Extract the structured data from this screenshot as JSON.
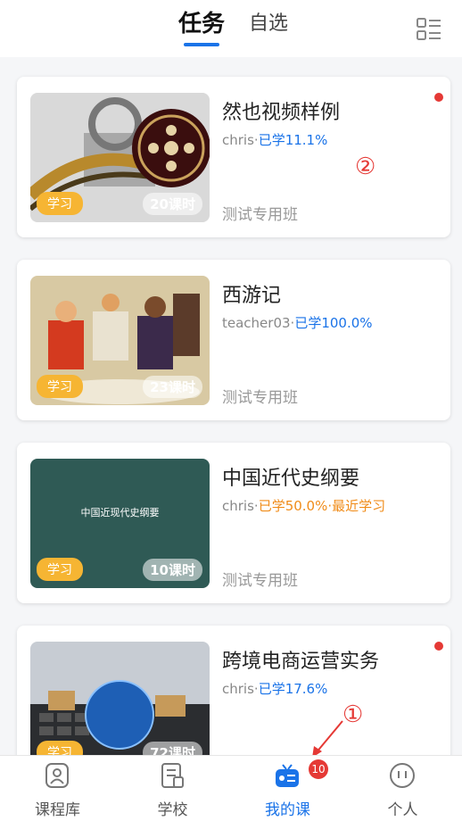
{
  "tabs": [
    {
      "label": "任务",
      "active": true
    },
    {
      "label": "自选",
      "active": false
    }
  ],
  "courses": [
    {
      "title": "然也视频样例",
      "teacher": "chris",
      "separator": "·",
      "progress": "已学11.1%",
      "progress_color": "#1a73e8",
      "study_badge": "学习",
      "hours": "20课时",
      "class_name": "测试专用班",
      "unread": true
    },
    {
      "title": "西游记",
      "teacher": "teacher03",
      "separator": "·",
      "progress": "已学100.0%",
      "progress_color": "#1a73e8",
      "study_badge": "学习",
      "hours": "23课时",
      "class_name": "测试专用班",
      "unread": false
    },
    {
      "title": "中国近代史纲要",
      "teacher": "chris",
      "separator": "·",
      "progress": "已学50.0%·最近学习",
      "progress_color": "#f08c1a",
      "study_badge": "学习",
      "hours": "10课时",
      "class_name": "测试专用班",
      "thumb_text": "中国近现代史纲要",
      "unread": false
    },
    {
      "title": "跨境电商运营实务",
      "teacher": "chris",
      "separator": "·",
      "progress": "已学17.6%",
      "progress_color": "#1a73e8",
      "study_badge": "学习",
      "hours": "72课时",
      "class_name": "测试专用班",
      "unread": true
    }
  ],
  "annotations": {
    "one": "①",
    "two": "②"
  },
  "bottom_nav": [
    {
      "label": "课程库",
      "icon": "course-library-icon"
    },
    {
      "label": "学校",
      "icon": "school-icon"
    },
    {
      "label": "我的课",
      "icon": "tv-icon",
      "active": true,
      "badge": "10"
    },
    {
      "label": "个人",
      "icon": "profile-icon"
    }
  ],
  "colors": {
    "accent": "#1a73e8",
    "orange": "#f08c1a",
    "badge": "#f6b533",
    "red": "#e53935"
  }
}
